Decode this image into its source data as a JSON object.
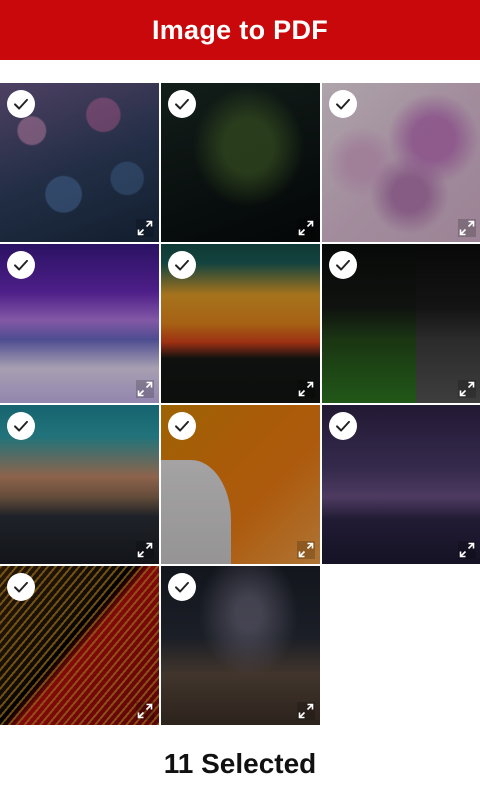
{
  "app": {
    "title": "Image to PDF"
  },
  "status": {
    "selected_text": "11 Selected"
  },
  "colors": {
    "header_bg": "#c8080a",
    "header_text": "#ffffff",
    "footer_text": "#111111"
  },
  "gallery": {
    "images": [
      {
        "name": "rainy-window-bokeh",
        "selected": true
      },
      {
        "name": "dark-starry-sky",
        "selected": true
      },
      {
        "name": "pink-floral-abstract",
        "selected": true
      },
      {
        "name": "purple-mountain-snow",
        "selected": true
      },
      {
        "name": "orange-sunset-palms",
        "selected": true
      },
      {
        "name": "tree-green-gray-split",
        "selected": true
      },
      {
        "name": "palm-street-sunset",
        "selected": true
      },
      {
        "name": "orange-abstract-waves",
        "selected": true
      },
      {
        "name": "purple-desert-dunes",
        "selected": true
      },
      {
        "name": "red-gold-light-streaks",
        "selected": true
      },
      {
        "name": "milky-way-rocks",
        "selected": true
      }
    ],
    "icons": {
      "check": "check-circle-icon",
      "expand": "expand-icon"
    }
  }
}
